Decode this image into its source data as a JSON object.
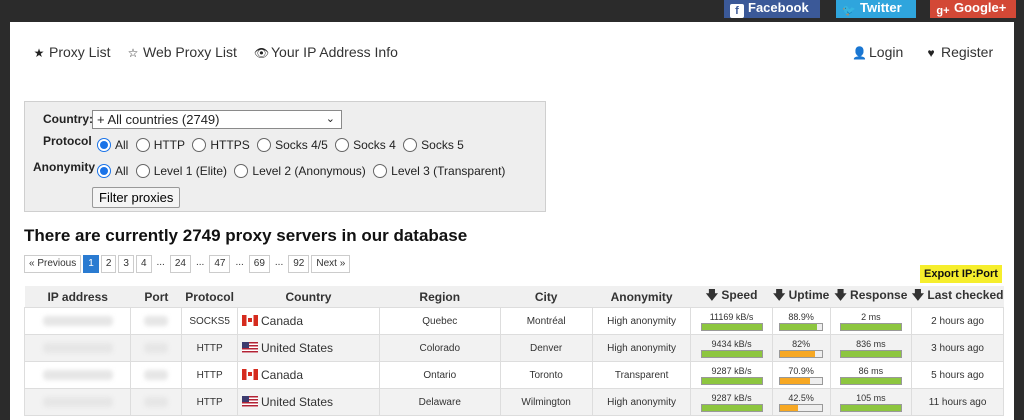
{
  "social": {
    "facebook": "Facebook",
    "twitter": "Twitter",
    "googleplus": "Google+"
  },
  "nav": {
    "proxy_list": "Proxy List",
    "web_proxy_list": "Web Proxy List",
    "ip_info": "Your IP Address Info",
    "login": "Login",
    "register": "Register"
  },
  "filter": {
    "country_label": "Country:",
    "country_value": "+ All countries (2749)",
    "protocol_label": "Protocol",
    "protocol_options": [
      "All",
      "HTTP",
      "HTTPS",
      "Socks 4/5",
      "Socks 4",
      "Socks 5"
    ],
    "protocol_selected": "All",
    "anonymity_label": "Anonymity",
    "anonymity_options": [
      "All",
      "Level 1 (Elite)",
      "Level 2 (Anonymous)",
      "Level 3 (Transparent)"
    ],
    "anonymity_selected": "All",
    "button": "Filter proxies"
  },
  "heading": "There are currently 2749 proxy servers in our database",
  "pager": {
    "prev": "« Previous",
    "pages": [
      "1",
      "2",
      "3",
      "4",
      "...",
      "24",
      "...",
      "47",
      "...",
      "69",
      "...",
      "92"
    ],
    "active": "1",
    "next": "Next »"
  },
  "export_label": "Export IP:Port",
  "table": {
    "headers": [
      "IP address",
      "Port",
      "Protocol",
      "Country",
      "Region",
      "City",
      "Anonymity",
      "Speed",
      "Uptime",
      "Response",
      "Last checked"
    ],
    "rows": [
      {
        "protocol": "SOCKS5",
        "country": "Canada",
        "flag": "ca",
        "region": "Quebec",
        "city": "Montréal",
        "anonymity": "High anonymity",
        "speed": "11169 kB/s",
        "speed_level": 1.0,
        "uptime": "88.9%",
        "uptime_level": 0.889,
        "uptime_color": "green",
        "response": "2 ms",
        "response_level": 1.0,
        "last_checked": "2 hours ago"
      },
      {
        "protocol": "HTTP",
        "country": "United States",
        "flag": "us",
        "region": "Colorado",
        "city": "Denver",
        "anonymity": "High anonymity",
        "speed": "9434 kB/s",
        "speed_level": 1.0,
        "uptime": "82%",
        "uptime_level": 0.82,
        "uptime_color": "orange",
        "response": "836 ms",
        "response_level": 1.0,
        "last_checked": "3 hours ago"
      },
      {
        "protocol": "HTTP",
        "country": "Canada",
        "flag": "ca",
        "region": "Ontario",
        "city": "Toronto",
        "anonymity": "Transparent",
        "speed": "9287 kB/s",
        "speed_level": 1.0,
        "uptime": "70.9%",
        "uptime_level": 0.709,
        "uptime_color": "orange",
        "response": "86 ms",
        "response_level": 1.0,
        "last_checked": "5 hours ago"
      },
      {
        "protocol": "HTTP",
        "country": "United States",
        "flag": "us",
        "region": "Delaware",
        "city": "Wilmington",
        "anonymity": "High anonymity",
        "speed": "9287 kB/s",
        "speed_level": 1.0,
        "uptime": "42.5%",
        "uptime_level": 0.425,
        "uptime_color": "orange",
        "response": "105 ms",
        "response_level": 1.0,
        "last_checked": "11 hours ago"
      }
    ]
  }
}
